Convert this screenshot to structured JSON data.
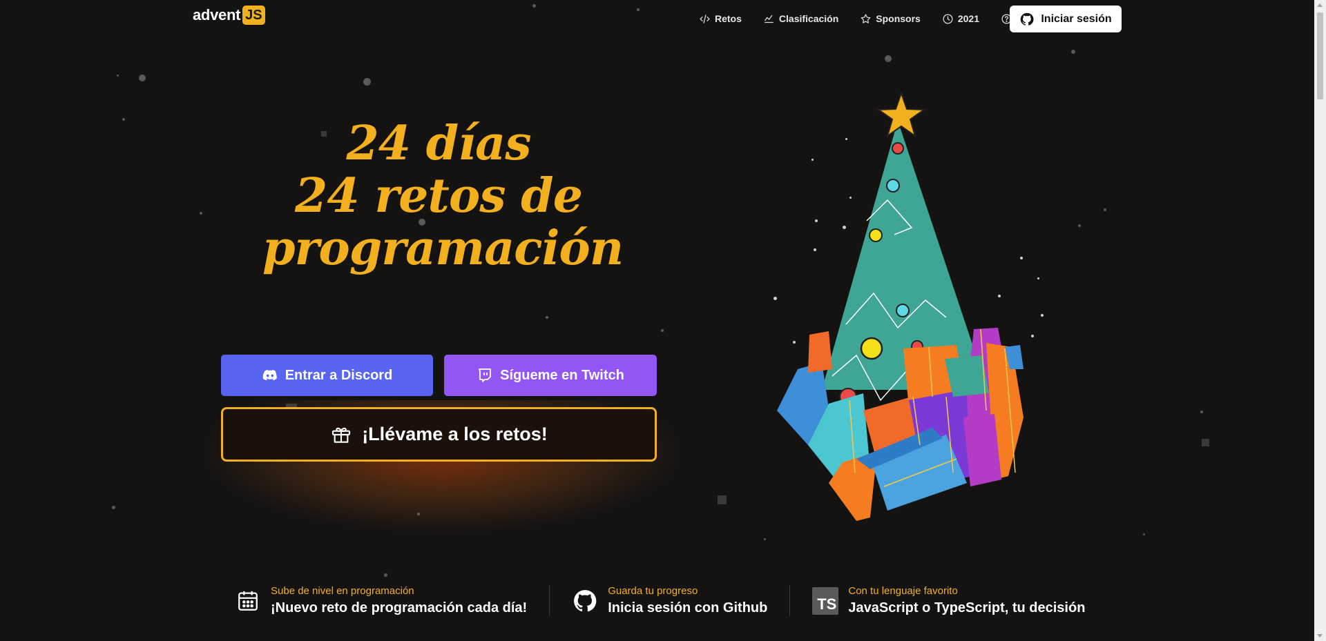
{
  "header": {
    "logo_text": "advent",
    "logo_badge": "JS",
    "nav": [
      {
        "label": "Retos",
        "icon": "code-icon"
      },
      {
        "label": "Clasificación",
        "icon": "chart-line-icon"
      },
      {
        "label": "Sponsors",
        "icon": "star-icon"
      },
      {
        "label": "2021",
        "icon": "clock-icon"
      }
    ],
    "help_icon": "question-circle-icon",
    "login_label": "Iniciar sesión"
  },
  "hero": {
    "title_line1": "24 días",
    "title_line2": "24 retos de",
    "title_line3": "programación",
    "discord_label": "Entrar a Discord",
    "twitch_label": "Sígueme en Twitch",
    "cta_label": "¡Llévame a los retos!"
  },
  "features": [
    {
      "icon": "calendar-icon",
      "title": "Sube de nivel en programación",
      "text": "¡Nuevo reto de programación cada día!"
    },
    {
      "icon": "github-icon",
      "title": "Guarda tu progreso",
      "text": "Inicia sesión con Github"
    },
    {
      "icon": "typescript-icon",
      "badge": "TS",
      "title": "Con tu lenguaje favorito",
      "text": "JavaScript o TypeScript, tu decisión"
    }
  ],
  "colors": {
    "accent": "#f2b01e",
    "background": "#141312",
    "discord": "#5865f2",
    "twitch": "#9156f3"
  }
}
